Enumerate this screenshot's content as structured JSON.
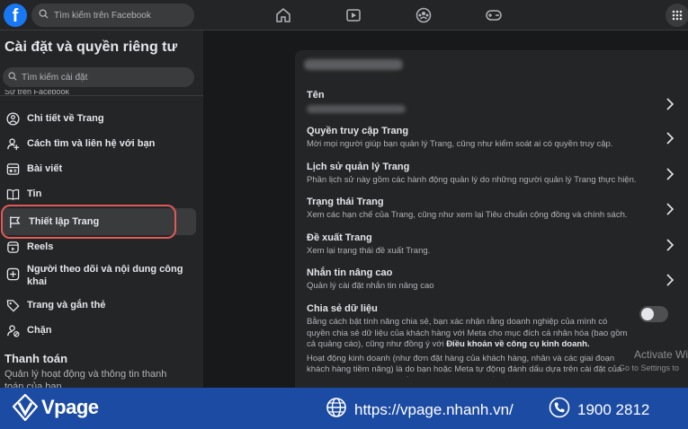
{
  "topbar": {
    "logo": "f",
    "search_placeholder": "Tìm kiếm trên Facebook",
    "nav_icons": [
      "home-icon",
      "video-icon",
      "groups-icon",
      "gaming-icon"
    ],
    "menu_icon": "grid-menu-icon"
  },
  "sidebar": {
    "title": "Cài đặt và quyền riêng tư",
    "search_placeholder": "Tìm kiếm cài đặt",
    "section_cut": "Sự trên Facebook",
    "items": [
      {
        "label": "Chi tiết về Trang",
        "icon": "info-person-icon"
      },
      {
        "label": "Cách tìm và liên hệ với bạn",
        "icon": "find-person-icon"
      },
      {
        "label": "Bài viết",
        "icon": "posts-icon"
      },
      {
        "label": "Tin",
        "icon": "stories-icon"
      },
      {
        "label": "Thiết lập Trang",
        "icon": "flag-icon"
      },
      {
        "label": "Reels",
        "icon": "reels-icon"
      },
      {
        "label": "Người theo dõi và nội dung công khai",
        "icon": "followers-icon"
      },
      {
        "label": "Trang và gắn thẻ",
        "icon": "tag-icon"
      },
      {
        "label": "Chặn",
        "icon": "block-icon"
      }
    ],
    "payment_title": "Thanh toán",
    "payment_desc": "Quản lý hoạt động và thông tin thanh toán của bạn"
  },
  "main": {
    "rows": [
      {
        "title": "Tên",
        "desc": ""
      },
      {
        "title": "Quyền truy cập Trang",
        "desc": "Mời mọi người giúp bạn quản lý Trang, cũng như kiểm soát ai có quyền truy cập."
      },
      {
        "title": "Lịch sử quản lý Trang",
        "desc": "Phần lịch sử này gồm các hành động quản lý do những người quản lý Trang thực hiện."
      },
      {
        "title": "Trạng thái Trang",
        "desc": "Xem các hạn chế của Trang, cũng như xem lại Tiêu chuẩn cộng đồng và chính sách."
      },
      {
        "title": "Đề xuất Trang",
        "desc": "Xem lại trạng thái đề xuất Trang."
      },
      {
        "title": "Nhắn tin nâng cao",
        "desc": "Quản lý cài đặt nhắn tin nâng cao"
      }
    ],
    "share": {
      "title": "Chia sẻ dữ liệu",
      "desc1": "Bằng cách bật tính năng chia sẻ, bạn xác nhận rằng doanh nghiệp của mình có quyền chia sẻ dữ liệu của khách hàng với Meta cho mục đích cá nhân hóa (bao gồm cả quảng cáo), cũng như đồng ý với ",
      "desc1_bold": "Điều khoản về công cụ kinh doanh.",
      "desc2": "Hoạt động kinh doanh (như đơn đặt hàng của khách hàng, nhân và các giai đoạn khách hàng tiềm năng) là do bạn hoặc Meta tự động đánh dấu dựa trên cài đặt của bạn. Chúng tôi cũng có thể sử dụng những chi tiết về hoạt động mà bạn chia sẻ",
      "toggle_on": false
    }
  },
  "watermark": {
    "line1": "Activate Wind",
    "line2": "Go to Settings to"
  },
  "banner": {
    "brand": "Vpage",
    "website": "https://vpage.nhanh.vn/",
    "phone": "1900 2812",
    "colors": {
      "background": "#1c4ba3"
    }
  }
}
